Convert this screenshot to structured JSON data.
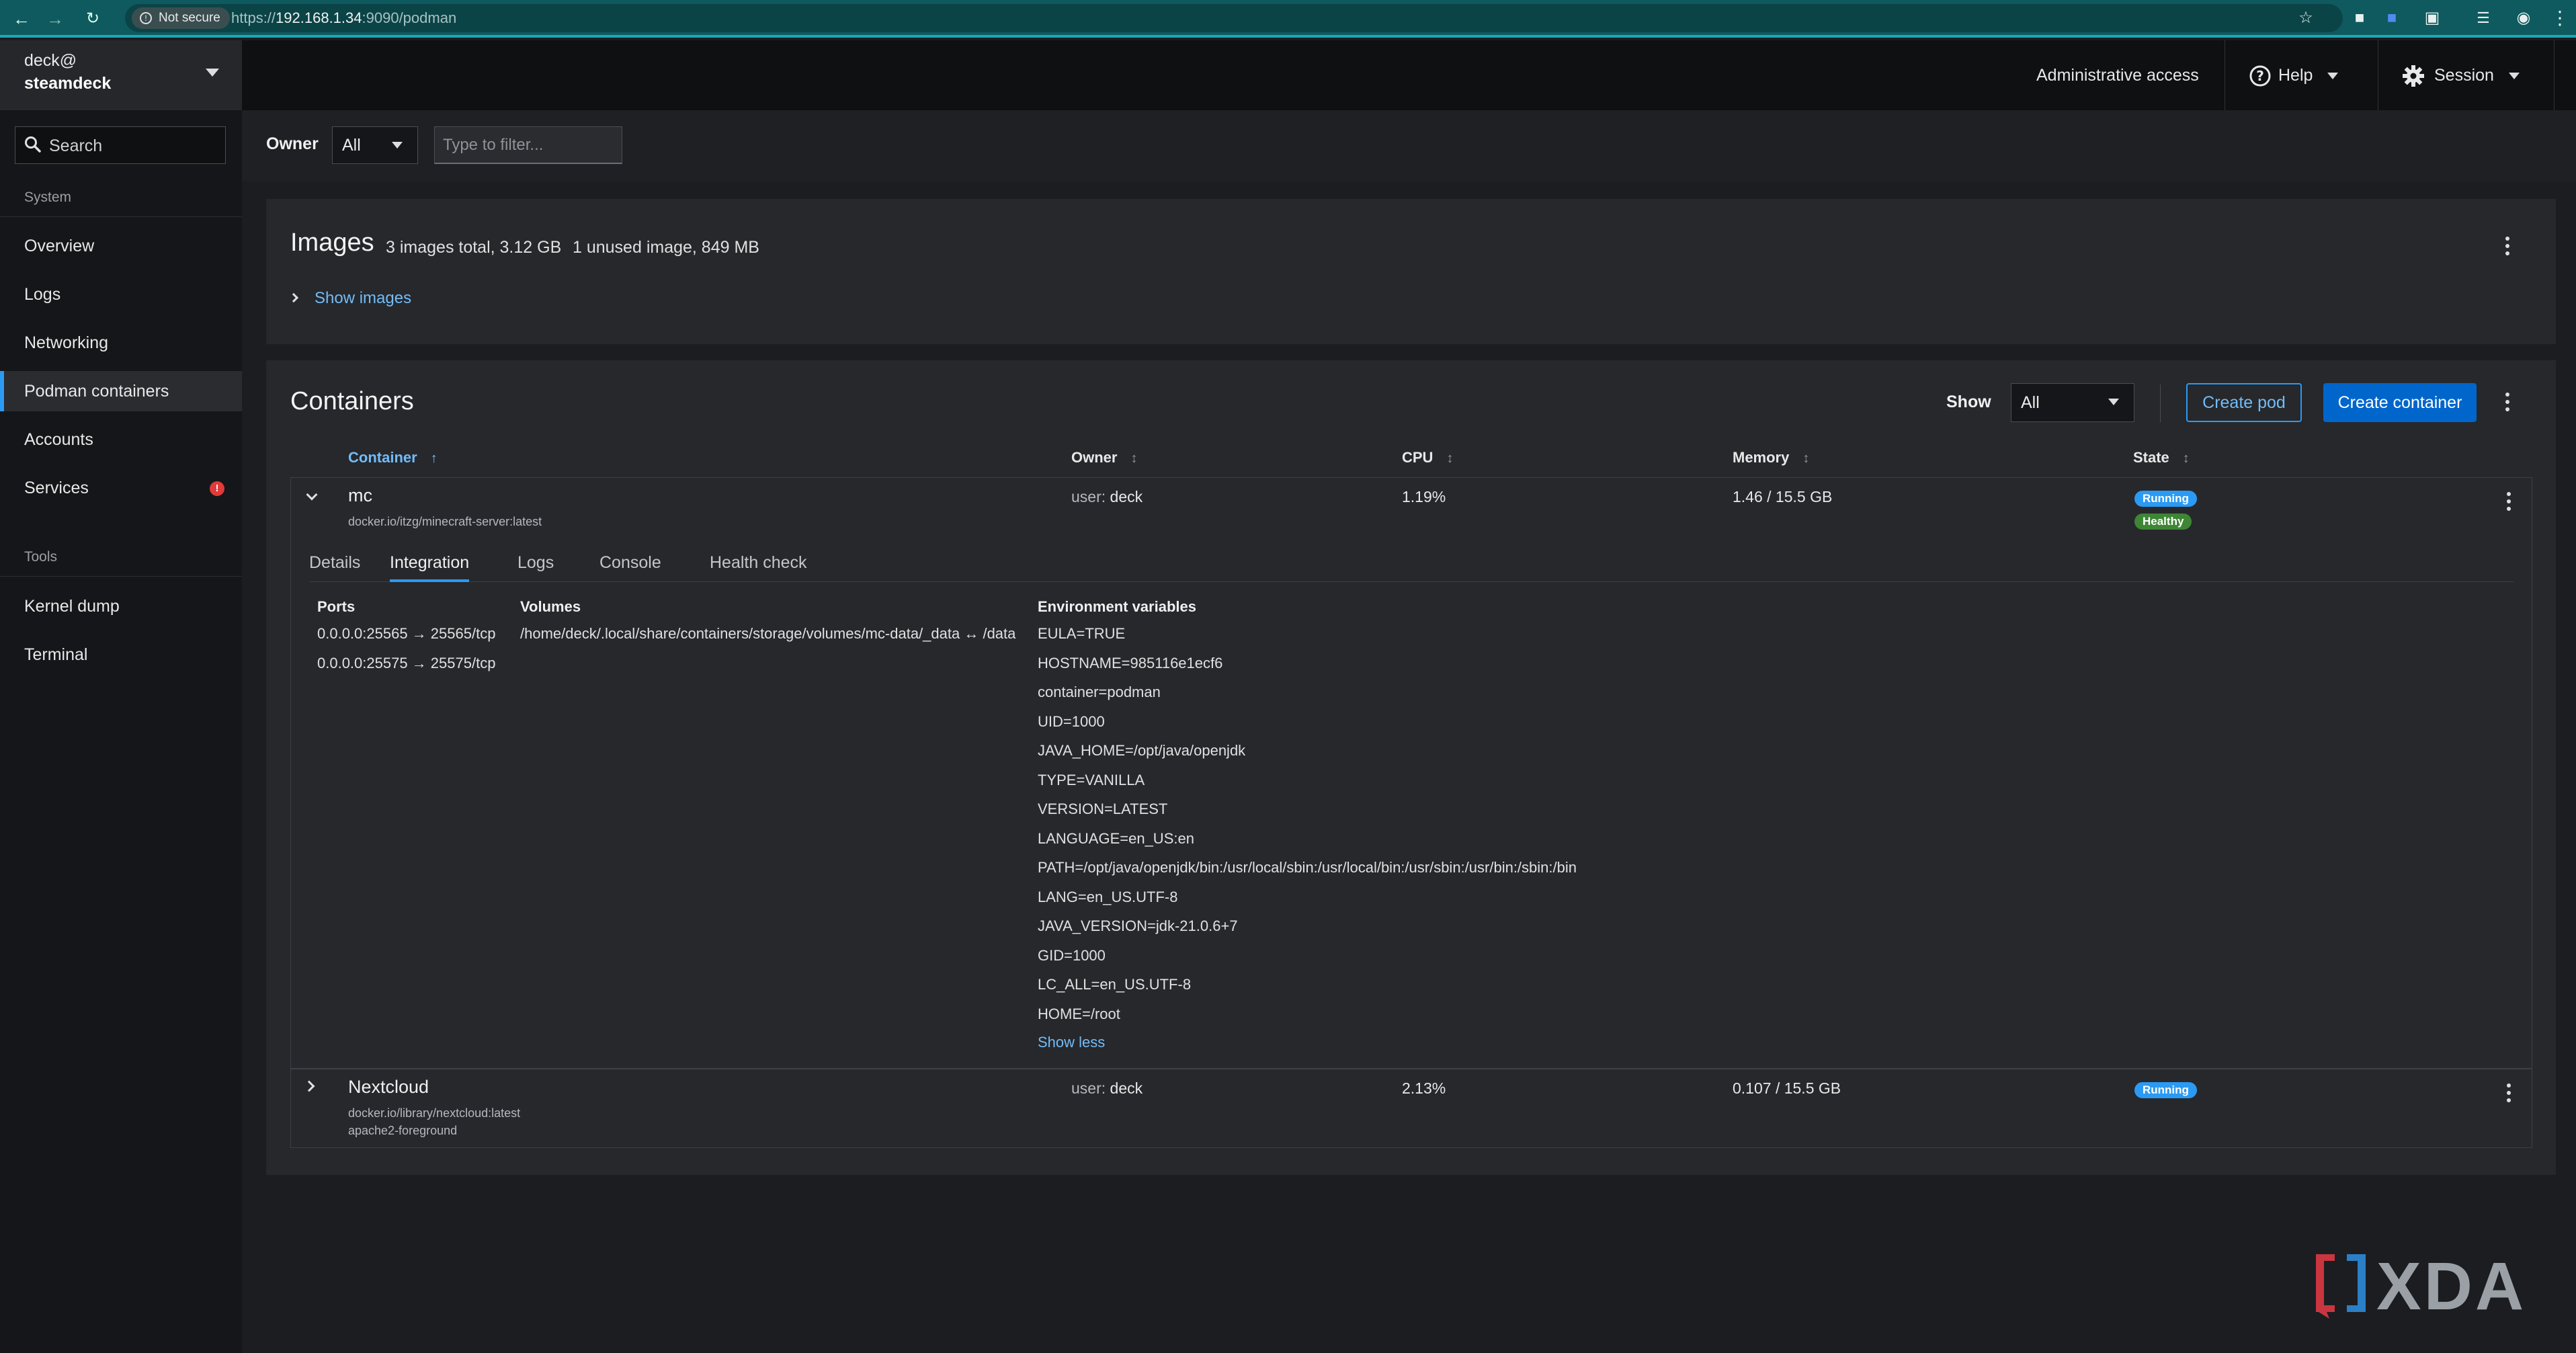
{
  "browser": {
    "security_label": "Not secure",
    "url_scheme": "https://",
    "url_host": "192.168.1.34",
    "url_rest": ":9090/podman"
  },
  "sidebar": {
    "user": "deck@",
    "host": "steamdeck",
    "search_label": "Search",
    "system_heading": "System",
    "system_items": [
      {
        "label": "Overview"
      },
      {
        "label": "Logs"
      },
      {
        "label": "Networking"
      },
      {
        "label": "Podman containers",
        "active": true
      },
      {
        "label": "Accounts"
      },
      {
        "label": "Services",
        "badge": "!"
      }
    ],
    "tools_heading": "Tools",
    "tools_items": [
      {
        "label": "Kernel dump"
      },
      {
        "label": "Terminal"
      }
    ]
  },
  "header": {
    "admin_access": "Administrative access",
    "help": "Help",
    "session": "Session"
  },
  "filter": {
    "owner_label": "Owner",
    "owner_value": "All",
    "filter_placeholder": "Type to filter..."
  },
  "images": {
    "title": "Images",
    "total": "3 images total, 3.12 GB",
    "unused": "1 unused image, 849 MB",
    "show_link": "Show images"
  },
  "containers": {
    "title": "Containers",
    "show_label": "Show",
    "show_value": "All",
    "create_pod": "Create pod",
    "create_container": "Create container",
    "columns": {
      "container": "Container",
      "owner": "Owner",
      "cpu": "CPU",
      "memory": "Memory",
      "state": "State"
    },
    "rows": [
      {
        "name": "mc",
        "image": "docker.io/itzg/minecraft-server:latest",
        "command": "",
        "owner_prefix": "user:",
        "owner": "deck",
        "cpu": "1.19%",
        "memory": "1.46 / 15.5 GB",
        "state": "Running",
        "health": "Healthy",
        "expanded": true
      },
      {
        "name": "Nextcloud",
        "image": "docker.io/library/nextcloud:latest",
        "command": "apache2-foreground",
        "owner_prefix": "user:",
        "owner": "deck",
        "cpu": "2.13%",
        "memory": "0.107 / 15.5 GB",
        "state": "Running",
        "health": "",
        "expanded": false
      }
    ],
    "tabs": [
      "Details",
      "Integration",
      "Logs",
      "Console",
      "Health check"
    ],
    "active_tab": "Integration",
    "integration": {
      "ports_label": "Ports",
      "ports": [
        "0.0.0.0:25565 → 25565/tcp",
        "0.0.0.0:25575 → 25575/tcp"
      ],
      "volumes_label": "Volumes",
      "volumes": [
        "/home/deck/.local/share/containers/storage/volumes/mc-data/_data ↔ /data"
      ],
      "env_label": "Environment variables",
      "env": [
        "EULA=TRUE",
        "HOSTNAME=985116e1ecf6",
        "container=podman",
        "UID=1000",
        "JAVA_HOME=/opt/java/openjdk",
        "TYPE=VANILLA",
        "VERSION=LATEST",
        "LANGUAGE=en_US:en",
        "PATH=/opt/java/openjdk/bin:/usr/local/sbin:/usr/local/bin:/usr/sbin:/usr/bin:/sbin:/bin",
        "LANG=en_US.UTF-8",
        "JAVA_VERSION=jdk-21.0.6+7",
        "GID=1000",
        "LC_ALL=en_US.UTF-8",
        "HOME=/root"
      ],
      "show_less": "Show less"
    }
  },
  "watermark": "XDA"
}
